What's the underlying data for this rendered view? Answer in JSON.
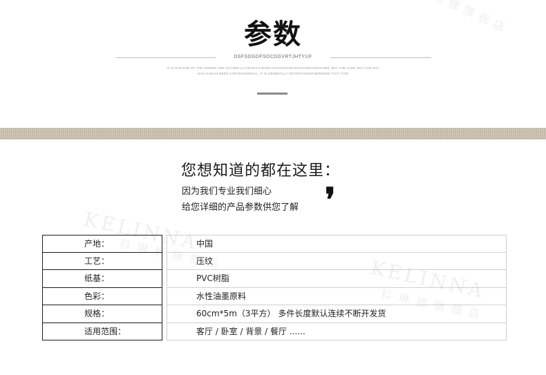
{
  "header": {
    "title": "参数",
    "code_line": "DSFSDGDFSDCDGVRTJHTYUF",
    "tagline_1": "IT IS THE END OF THE SPRING AND AUTUMN LU HONGYU MADE HISTORIOGRAPHISTORIOGRAPHER. BUT THE AUZR. BUT THE AUT",
    "tagline_2": "HAS ALWAYS BEEN CONTROVERSIAL. IT IS GENERALLY OSTORIOGRAPHERDEREI THAT THIS"
  },
  "intro": {
    "heading": "您想知道的都在这里：",
    "line_1": "因为我们专业我们细心",
    "line_2": "给您详细的产品参数供您了解",
    "quote_mark": "❜"
  },
  "watermark": {
    "brand": "KELINNA",
    "store": "科琳娜旗舰店"
  },
  "specs": [
    {
      "label": "产地：",
      "value": "中国"
    },
    {
      "label": "工艺：",
      "value": "压纹"
    },
    {
      "label": "纸基：",
      "value": "PVC树脂"
    },
    {
      "label": "色彩：",
      "value": "水性油墨原料"
    },
    {
      "label": "规格：",
      "value": "60cm*5m（3平方） 多件长度默认连续不断开发货"
    },
    {
      "label": "适用范围：",
      "value": "客厅 / 卧室 / 背景 / 餐厅 ......"
    }
  ],
  "colors": {
    "linen_band": "#cfc3b1",
    "accent_bar": "#8a8a8a"
  }
}
